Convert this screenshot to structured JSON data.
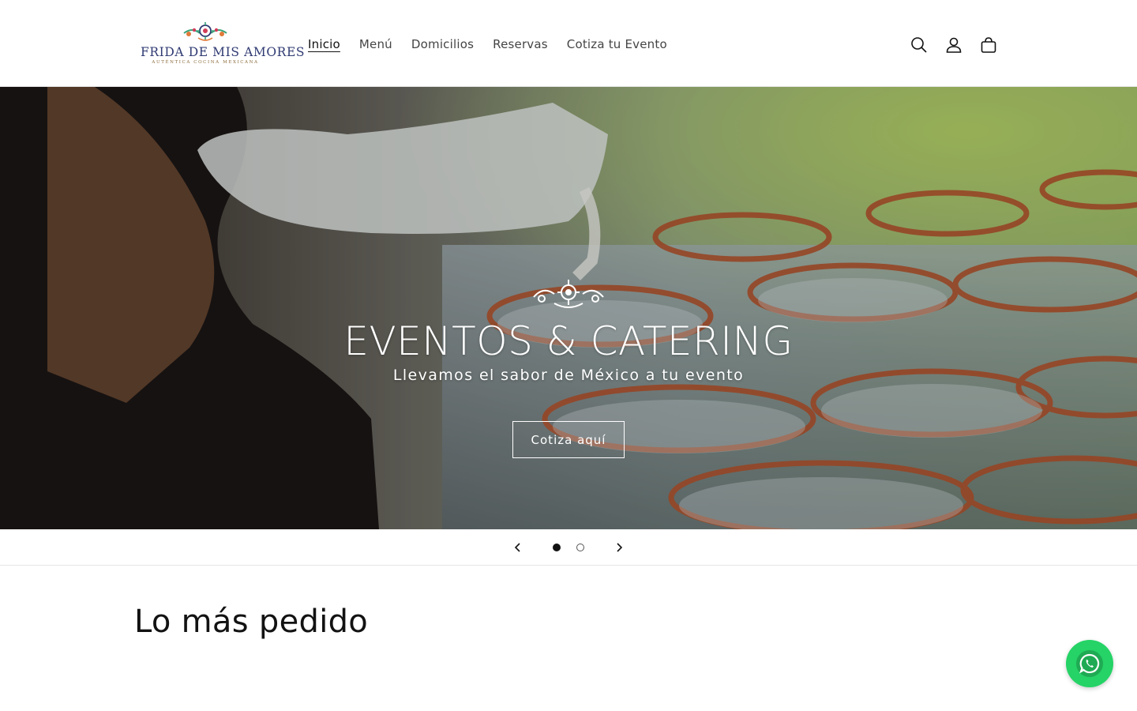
{
  "brand": {
    "name": "FRIDA DE MIS AMORES",
    "tagline": "AUTÉNTICA COCINA MEXICANA"
  },
  "nav": {
    "items": [
      {
        "label": "Inicio",
        "active": true
      },
      {
        "label": "Menú",
        "active": false
      },
      {
        "label": "Domicilios",
        "active": false
      },
      {
        "label": "Reservas",
        "active": false
      },
      {
        "label": "Cotiza tu Evento",
        "active": false
      }
    ]
  },
  "header_icons": [
    "search-icon",
    "account-icon",
    "cart-icon"
  ],
  "hero": {
    "title": "EVENTOS & CATERING",
    "subtitle": "Llevamos el sabor de México a tu evento",
    "button_label": "Cotiza aquí"
  },
  "slider": {
    "slide_count": 2,
    "active_slide": 1
  },
  "section": {
    "title": "Lo más pedido"
  },
  "colors": {
    "whatsapp": "#25d366",
    "brand_text": "#2f3a72",
    "text": "#121212"
  }
}
